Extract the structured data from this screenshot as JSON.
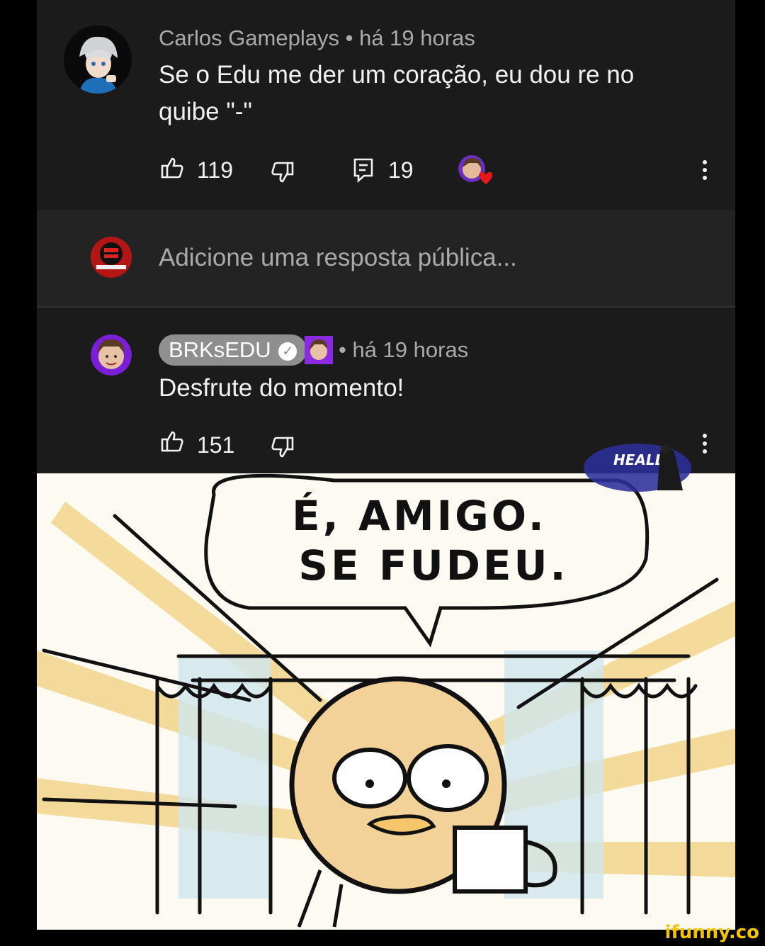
{
  "comment": {
    "author": "Carlos Gameplays",
    "time": "• há 19 horas",
    "text": "Se o Edu me der um coração, eu dou re no quibe \"-\"",
    "likes": "119",
    "replies": "19"
  },
  "reply_box": {
    "placeholder": "Adicione uma resposta pública..."
  },
  "reply": {
    "author": "BRKsEDU",
    "time": "• há 19 horas",
    "text": "Desfrute do momento!",
    "likes": "151"
  },
  "meme": {
    "line1": "É, AMIGO.",
    "line2": "SE FUDEU."
  },
  "overlay_logo": "HEALL",
  "watermark": "ifunny.co",
  "colors": {
    "background": "#1b1b1b",
    "reply_box": "#232323",
    "heart": "#e5191b",
    "chip": "#8f8f8f",
    "watermark": "#f5c400"
  }
}
